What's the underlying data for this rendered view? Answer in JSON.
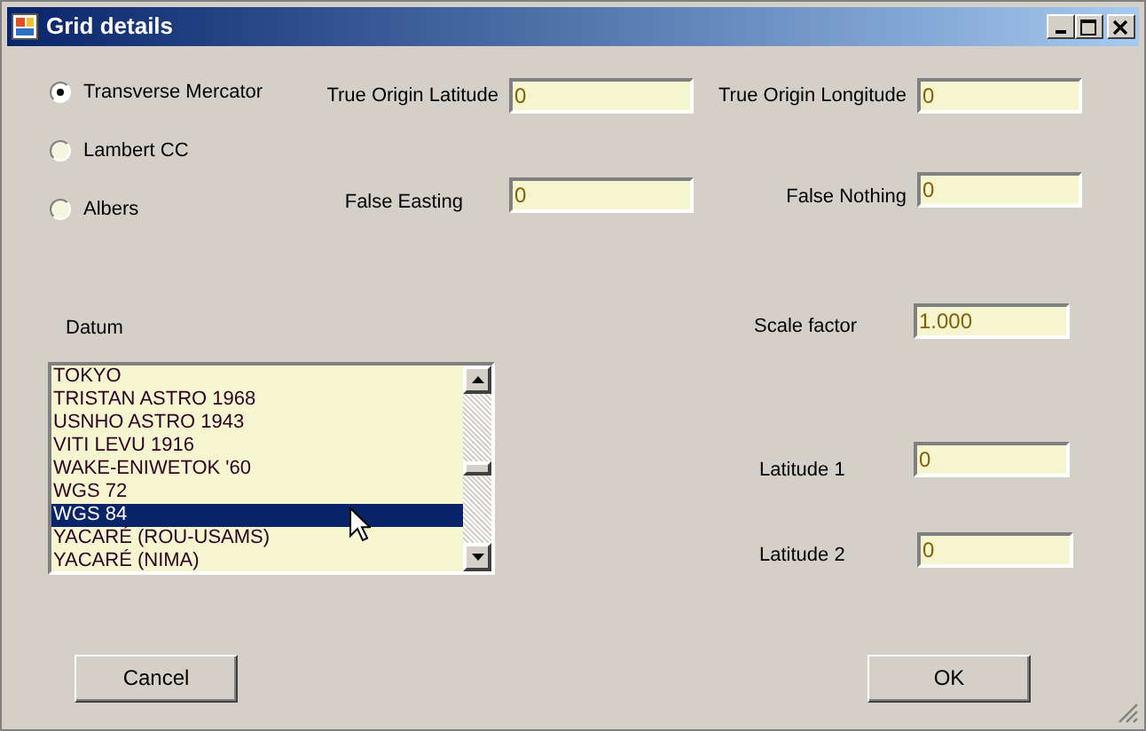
{
  "window": {
    "title": "Grid details"
  },
  "projections": [
    {
      "label": "Transverse Mercator",
      "selected": true
    },
    {
      "label": "Lambert CC",
      "selected": false
    },
    {
      "label": "Albers",
      "selected": false
    }
  ],
  "top_fields": [
    {
      "label": "True Origin Latitude",
      "value": "0"
    },
    {
      "label": "True Origin Longitude",
      "value": "0"
    },
    {
      "label": "False Easting",
      "value": "0"
    },
    {
      "label": "False Nothing",
      "value": "0"
    }
  ],
  "datum": {
    "label": "Datum",
    "items": [
      {
        "label": "TOKYO",
        "selected": false
      },
      {
        "label": "TRISTAN ASTRO 1968",
        "selected": false
      },
      {
        "label": "USNHO ASTRO 1943",
        "selected": false
      },
      {
        "label": "VITI LEVU 1916",
        "selected": false
      },
      {
        "label": "WAKE-ENIWETOK '60",
        "selected": false
      },
      {
        "label": "WGS 72",
        "selected": false
      },
      {
        "label": "WGS 84",
        "selected": true
      },
      {
        "label": "YACARÉ (ROU-USAMS)",
        "selected": false
      },
      {
        "label": "YACARÉ (NIMA)",
        "selected": false
      }
    ]
  },
  "right_fields": [
    {
      "label": "Scale factor",
      "value": "1.000"
    },
    {
      "label": "Latitude 1",
      "value": "0"
    },
    {
      "label": "Latitude 2",
      "value": "0"
    }
  ],
  "buttons": [
    "Cancel",
    "OK"
  ]
}
